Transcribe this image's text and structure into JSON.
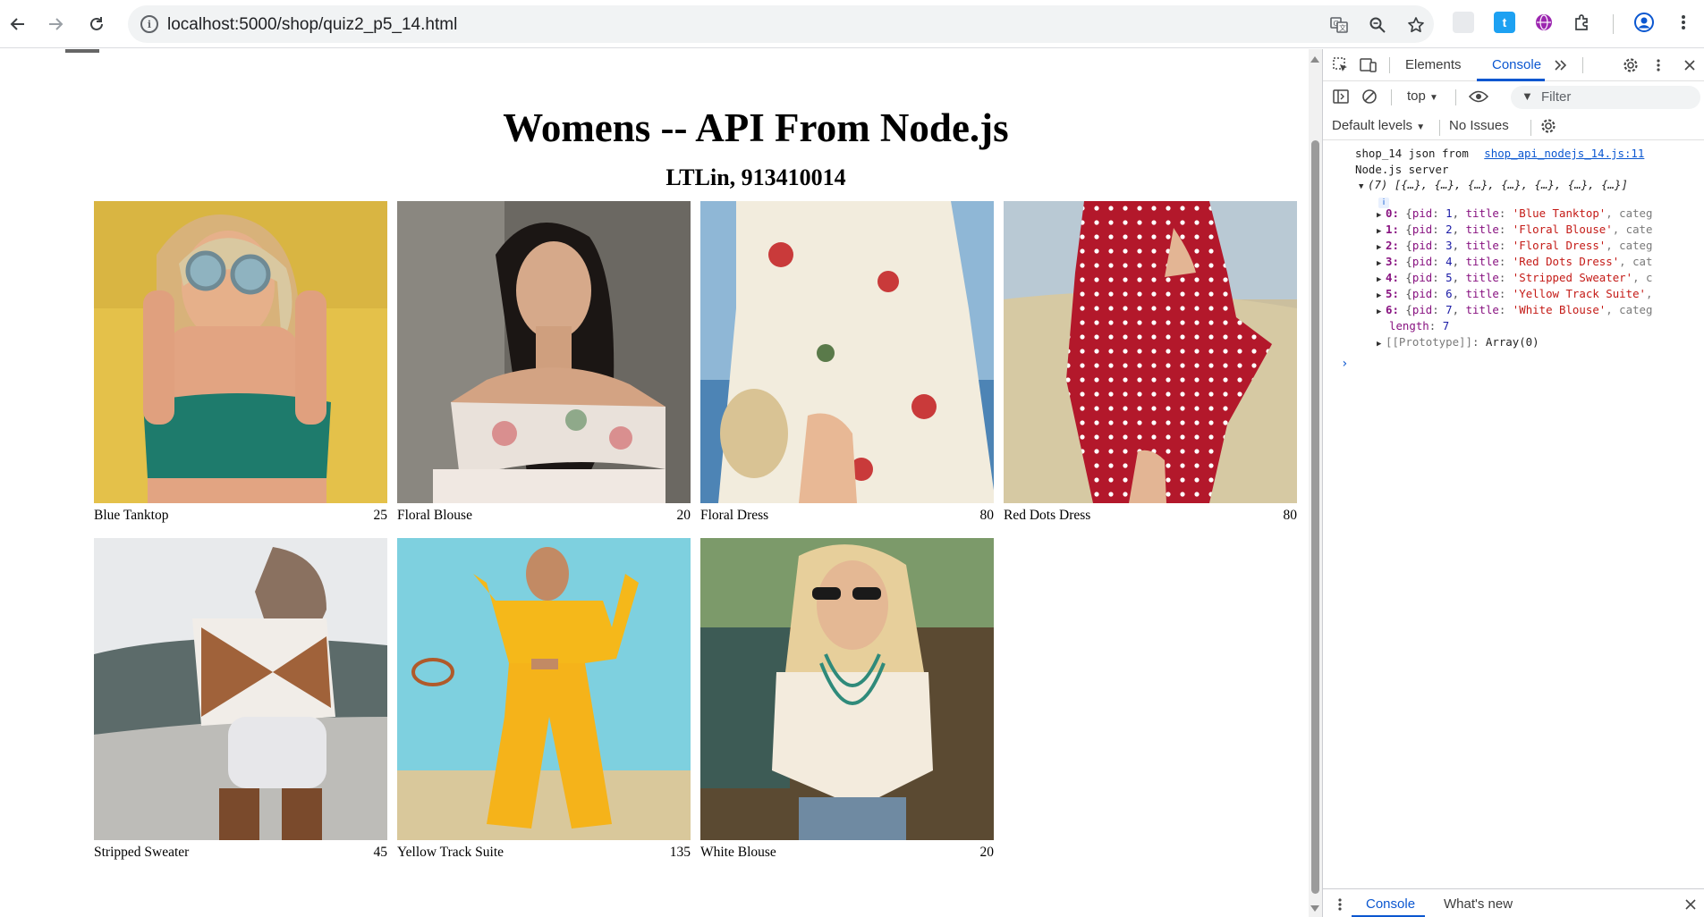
{
  "browser": {
    "url": "localhost:5000/shop/quiz2_p5_14.html",
    "back_icon": "arrow-left-icon",
    "forward_icon": "arrow-right-icon",
    "reload_icon": "reload-icon"
  },
  "page": {
    "title": "Womens -- API From Node.js",
    "subtitle": "LTLin, 913410014",
    "products": [
      {
        "name": "Blue Tanktop",
        "price": "25"
      },
      {
        "name": "Floral Blouse",
        "price": "20"
      },
      {
        "name": "Floral Dress",
        "price": "80"
      },
      {
        "name": "Red Dots Dress",
        "price": "80"
      },
      {
        "name": "Stripped Sweater",
        "price": "45"
      },
      {
        "name": "Yellow Track Suite",
        "price": "135"
      },
      {
        "name": "White Blouse",
        "price": "20"
      }
    ]
  },
  "devtools": {
    "tabs": {
      "elements": "Elements",
      "console": "Console"
    },
    "context": "top",
    "filter_placeholder": "Filter",
    "default_levels": "Default levels",
    "issues": "No Issues",
    "console": {
      "log_text_line1": "shop_14 json from",
      "log_text_line2": "Node.js server",
      "source_link": "shop_api_nodejs_14.js:11",
      "array_summary": "(7) [{…}, {…}, {…}, {…}, {…}, {…}, {…}]",
      "items": [
        {
          "index": "0:",
          "pid": "1",
          "title": "'Blue Tanktop'",
          "tail": ", categ"
        },
        {
          "index": "1:",
          "pid": "2",
          "title": "'Floral Blouse'",
          "tail": ", cate"
        },
        {
          "index": "2:",
          "pid": "3",
          "title": "'Floral Dress'",
          "tail": ", categ"
        },
        {
          "index": "3:",
          "pid": "4",
          "title": "'Red Dots Dress'",
          "tail": ", cat"
        },
        {
          "index": "4:",
          "pid": "5",
          "title": "'Stripped Sweater'",
          "tail": ", c"
        },
        {
          "index": "5:",
          "pid": "6",
          "title": "'Yellow Track Suite'",
          "tail": ","
        },
        {
          "index": "6:",
          "pid": "7",
          "title": "'White Blouse'",
          "tail": ", categ"
        }
      ],
      "length_key": "length",
      "length_value": "7",
      "prototype_key": "[[Prototype]]",
      "prototype_value": "Array(0)"
    },
    "drawer": {
      "console": "Console",
      "whats_new": "What's new"
    }
  }
}
